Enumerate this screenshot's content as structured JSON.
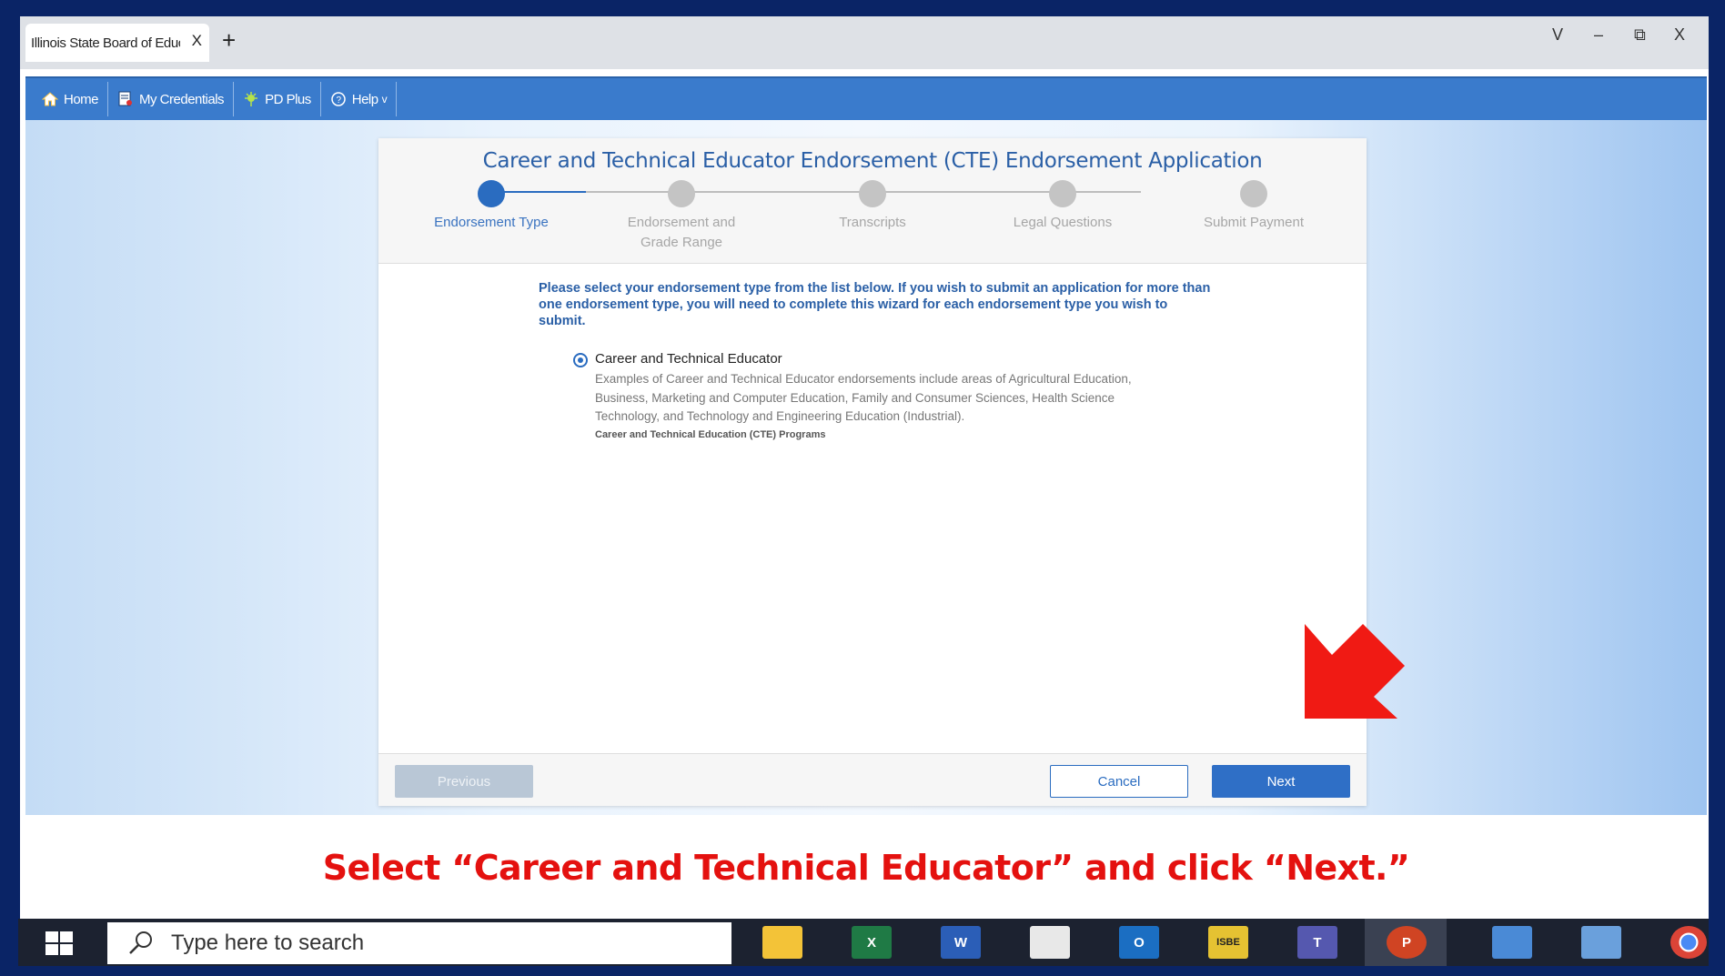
{
  "browser": {
    "tab_title": "Illinois State Board of Education",
    "tab_close": "X",
    "new_tab": "+",
    "controls": {
      "dropdown": "V",
      "minimize": "–",
      "restore": "⧉",
      "close": "X"
    }
  },
  "nav": {
    "items": [
      {
        "label": "Home",
        "icon": "home-icon"
      },
      {
        "label": "My Credentials",
        "icon": "credentials-icon"
      },
      {
        "label": "PD Plus",
        "icon": "pd-plus-icon"
      },
      {
        "label": "Help",
        "icon": "help-icon",
        "suffix": "v"
      }
    ]
  },
  "wizard": {
    "title": "Career and Technical Educator Endorsement (CTE) Endorsement Application",
    "steps": [
      {
        "label": "Endorsement Type",
        "active": true
      },
      {
        "label": "Endorsement and Grade Range",
        "active": false
      },
      {
        "label": "Transcripts",
        "active": false
      },
      {
        "label": "Legal Questions",
        "active": false
      },
      {
        "label": "Submit Payment",
        "active": false
      }
    ],
    "intro": "Please select your endorsement type from the list below. If you wish to submit an application for more than one endorsement type, you will need to complete this wizard for each endorsement type you wish to submit.",
    "option": {
      "label": "Career and Technical Educator",
      "selected": true,
      "description": "Examples of Career and Technical Educator endorsements include areas of Agricultural Education, Business, Marketing and Computer Education, Family and Consumer Sciences, Health Science Technology, and Technology and Engineering Education (Industrial).",
      "link": "Career and Technical Education (CTE) Programs"
    },
    "buttons": {
      "previous": "Previous",
      "cancel": "Cancel",
      "next": "Next"
    }
  },
  "caption": "Select “Career and Technical Educator” and click “Next.”",
  "taskbar": {
    "search_placeholder": "Type here to search",
    "apps": [
      {
        "name": "file-explorer-icon",
        "color": "#f3c338"
      },
      {
        "name": "excel-icon",
        "glyph": "X",
        "color": "#1f7a45"
      },
      {
        "name": "word-icon",
        "glyph": "W",
        "color": "#2b5eb7"
      },
      {
        "name": "snipping-tool-icon",
        "color": "#e8e8e8"
      },
      {
        "name": "outlook-icon",
        "glyph": "O",
        "color": "#1b6ec2"
      },
      {
        "name": "isbe-icon",
        "glyph": "ISBE",
        "color": "#e5c232"
      },
      {
        "name": "teams-icon",
        "glyph": "T",
        "color": "#5558af"
      },
      {
        "name": "powerpoint-icon",
        "glyph": "P",
        "color": "#d04423"
      },
      {
        "name": "laptop-icon",
        "color": "#4a8ad6"
      },
      {
        "name": "calculator-icon",
        "color": "#6aa0dc"
      },
      {
        "name": "chrome-icon",
        "color": "#db4437"
      }
    ]
  },
  "colors": {
    "accent": "#2a6cc0",
    "nav_bg": "#3a7bcc",
    "caption_red": "#e4110f"
  }
}
